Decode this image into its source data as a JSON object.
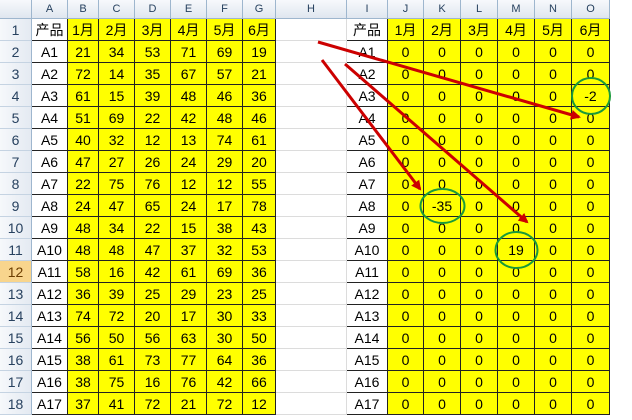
{
  "column_headers": [
    "A",
    "B",
    "C",
    "D",
    "E",
    "F",
    "G",
    "H",
    "I",
    "J",
    "K",
    "L",
    "M",
    "N",
    "O"
  ],
  "row_numbers": [
    "1",
    "2",
    "3",
    "4",
    "5",
    "6",
    "7",
    "8",
    "9",
    "10",
    "11",
    "12",
    "13",
    "14",
    "15",
    "16",
    "17",
    "18"
  ],
  "selected_row": "12",
  "left_table": {
    "header": [
      "产品",
      "1月",
      "2月",
      "3月",
      "4月",
      "5月",
      "6月"
    ],
    "rows": [
      [
        "A1",
        "21",
        "34",
        "53",
        "71",
        "69",
        "19"
      ],
      [
        "A2",
        "72",
        "14",
        "35",
        "67",
        "57",
        "21"
      ],
      [
        "A3",
        "61",
        "15",
        "39",
        "48",
        "46",
        "36"
      ],
      [
        "A4",
        "51",
        "69",
        "22",
        "42",
        "48",
        "46"
      ],
      [
        "A5",
        "40",
        "32",
        "12",
        "13",
        "74",
        "61"
      ],
      [
        "A6",
        "47",
        "27",
        "26",
        "24",
        "29",
        "20"
      ],
      [
        "A7",
        "22",
        "75",
        "76",
        "12",
        "12",
        "55"
      ],
      [
        "A8",
        "24",
        "47",
        "65",
        "24",
        "17",
        "78"
      ],
      [
        "A9",
        "48",
        "34",
        "22",
        "15",
        "38",
        "43"
      ],
      [
        "A10",
        "48",
        "48",
        "47",
        "37",
        "32",
        "53"
      ],
      [
        "A11",
        "58",
        "16",
        "42",
        "61",
        "69",
        "36"
      ],
      [
        "A12",
        "36",
        "39",
        "25",
        "29",
        "23",
        "25"
      ],
      [
        "A13",
        "74",
        "72",
        "20",
        "17",
        "30",
        "33"
      ],
      [
        "A14",
        "56",
        "50",
        "56",
        "63",
        "30",
        "50"
      ],
      [
        "A15",
        "38",
        "61",
        "73",
        "77",
        "64",
        "36"
      ],
      [
        "A16",
        "38",
        "75",
        "16",
        "76",
        "42",
        "66"
      ],
      [
        "A17",
        "37",
        "41",
        "72",
        "21",
        "72",
        "12"
      ]
    ]
  },
  "right_table": {
    "header": [
      "产品",
      "1月",
      "2月",
      "3月",
      "4月",
      "5月",
      "6月"
    ],
    "rows": [
      [
        "A1",
        "0",
        "0",
        "0",
        "0",
        "0",
        "0"
      ],
      [
        "A2",
        "0",
        "0",
        "0",
        "0",
        "0",
        "0"
      ],
      [
        "A3",
        "0",
        "0",
        "0",
        "0",
        "0",
        "-2"
      ],
      [
        "A4",
        "0",
        "0",
        "0",
        "0",
        "0",
        "0"
      ],
      [
        "A5",
        "0",
        "0",
        "0",
        "0",
        "0",
        "0"
      ],
      [
        "A6",
        "0",
        "0",
        "0",
        "0",
        "0",
        "0"
      ],
      [
        "A7",
        "0",
        "0",
        "0",
        "0",
        "0",
        "0"
      ],
      [
        "A8",
        "0",
        "-35",
        "0",
        "0",
        "0",
        "0"
      ],
      [
        "A9",
        "0",
        "0",
        "0",
        "0",
        "0",
        "0"
      ],
      [
        "A10",
        "0",
        "0",
        "0",
        "19",
        "0",
        "0"
      ],
      [
        "A11",
        "0",
        "0",
        "0",
        "0",
        "0",
        "0"
      ],
      [
        "A12",
        "0",
        "0",
        "0",
        "0",
        "0",
        "0"
      ],
      [
        "A13",
        "0",
        "0",
        "0",
        "0",
        "0",
        "0"
      ],
      [
        "A14",
        "0",
        "0",
        "0",
        "0",
        "0",
        "0"
      ],
      [
        "A15",
        "0",
        "0",
        "0",
        "0",
        "0",
        "0"
      ],
      [
        "A16",
        "0",
        "0",
        "0",
        "0",
        "0",
        "0"
      ],
      [
        "A17",
        "0",
        "0",
        "0",
        "0",
        "0",
        "0"
      ]
    ]
  },
  "highlights": [
    {
      "table": "right",
      "row": 2,
      "col": 6,
      "value": "-2"
    },
    {
      "table": "right",
      "row": 7,
      "col": 2,
      "value": "-35"
    },
    {
      "table": "right",
      "row": 9,
      "col": 4,
      "value": "19"
    }
  ],
  "colors": {
    "cell_fill": "#ffff00",
    "arrow": "#cc0000",
    "circle": "#1a9a3a",
    "selected_row_header": "#f8d58d"
  }
}
